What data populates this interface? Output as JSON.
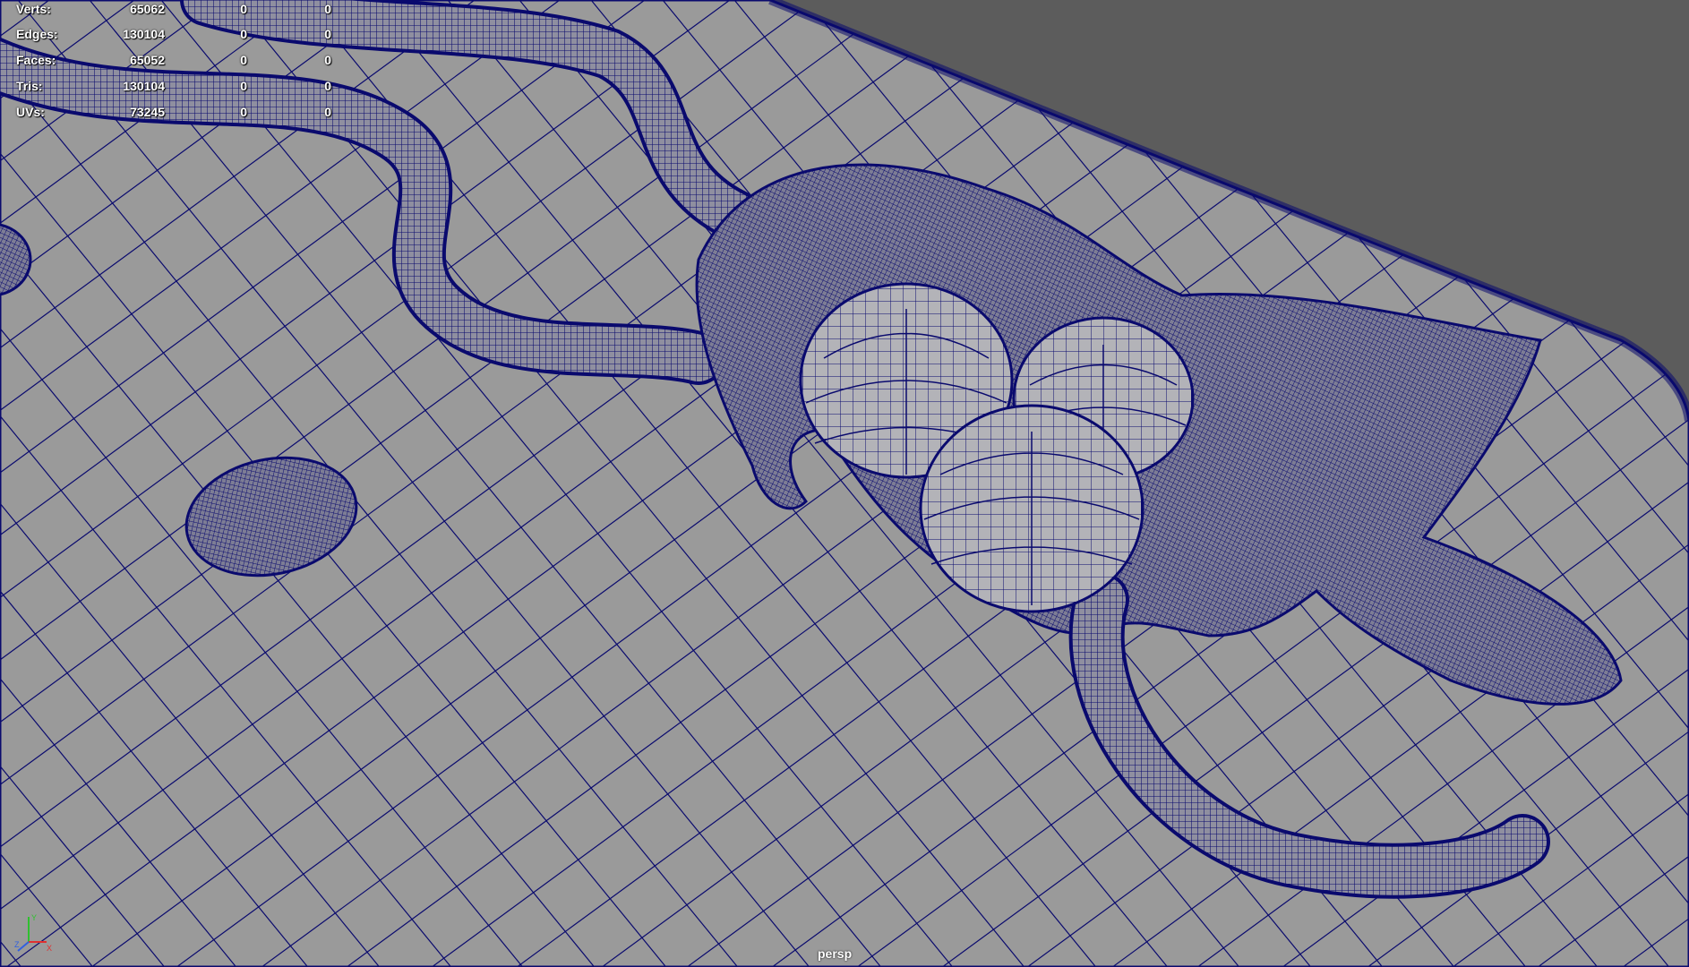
{
  "app": {
    "viewport_background": "#5c5c5c",
    "grid_surface_color": "#9a9a9a",
    "wireframe_color": "#0a0a6e",
    "hud_text_color": "#ffffff"
  },
  "heads_up_display": {
    "rows": [
      {
        "label": "Verts:",
        "total": "65062",
        "selected": "0",
        "component": "0"
      },
      {
        "label": "Edges:",
        "total": "130104",
        "selected": "0",
        "component": "0"
      },
      {
        "label": "Faces:",
        "total": "65052",
        "selected": "0",
        "component": "0"
      },
      {
        "label": "Tris:",
        "total": "130104",
        "selected": "0",
        "component": "0"
      },
      {
        "label": "UVs:",
        "total": "73245",
        "selected": "0",
        "component": "0"
      }
    ]
  },
  "camera": {
    "name": "persp"
  },
  "axis_gizmo": {
    "x_label": "X",
    "y_label": "Y",
    "z_label": "Z",
    "x_color": "#e03030",
    "y_color": "#30c030",
    "z_color": "#3060e0"
  }
}
